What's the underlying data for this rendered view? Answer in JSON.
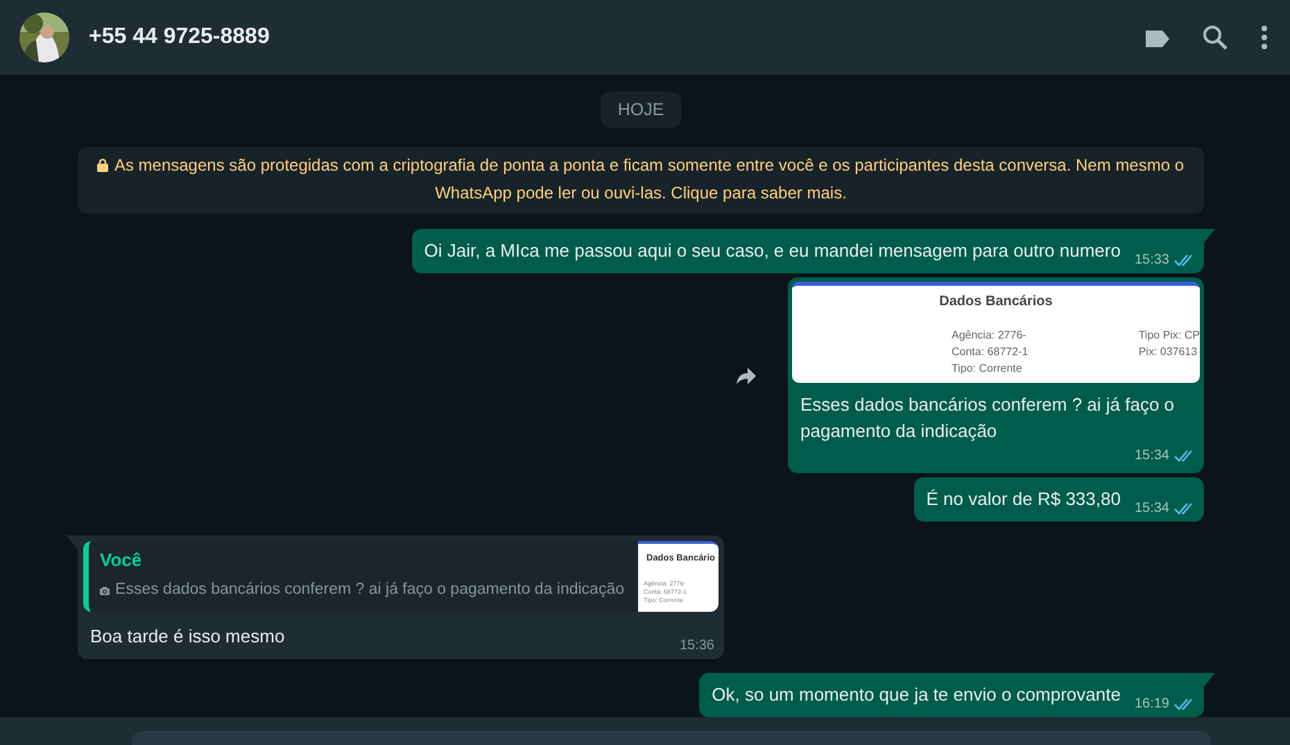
{
  "header": {
    "contact": "+55 44 9725-8889"
  },
  "date_chip": "HOJE",
  "encryption_notice": {
    "text": "As mensagens são protegidas com a criptografia de ponta a ponta e ficam somente entre você e os participantes desta conversa. Nem mesmo o WhatsApp pode ler ou ouvi-las. Clique para saber mais."
  },
  "messages": [
    {
      "kind": "text",
      "outgoing": true,
      "text": "Oi Jair, a MIca me passou aqui o seu caso, e eu mandei mensagem para outro numero",
      "time": "15:33",
      "read": true
    },
    {
      "outgoing": true,
      "image": {
        "title": "Dados Bancários",
        "left_lines": [
          "Agência: 2776-",
          "Conta: 68772-1",
          "Tipo: Corrente"
        ],
        "right_lines": [
          "Tipo Pix: CP",
          "Pix: 037613"
        ]
      },
      "text": "Esses dados bancários conferem ? ai já faço o pagamento da indicação",
      "time": "15:34",
      "read": true
    },
    {
      "kind": "text",
      "outgoing": true,
      "text": "É no valor de R$ 333,80",
      "time": "15:34",
      "read": true
    },
    {
      "kind": "reply",
      "outgoing": false,
      "quote": {
        "author": "Você",
        "text": "Esses dados bancários conferem ? ai já faço o pagamento da indicação",
        "thumb": {
          "title": "Dados Bancário",
          "lines": [
            "Agência: 2776-",
            "Conta: 68772-1",
            "Tipo: Corrente"
          ]
        }
      },
      "text": "Boa tarde é isso mesmo",
      "time": "15:36"
    },
    {
      "kind": "text",
      "outgoing": true,
      "text": "Ok, so um momento que ja te envio o comprovante",
      "time": "16:19",
      "read": true
    }
  ]
}
